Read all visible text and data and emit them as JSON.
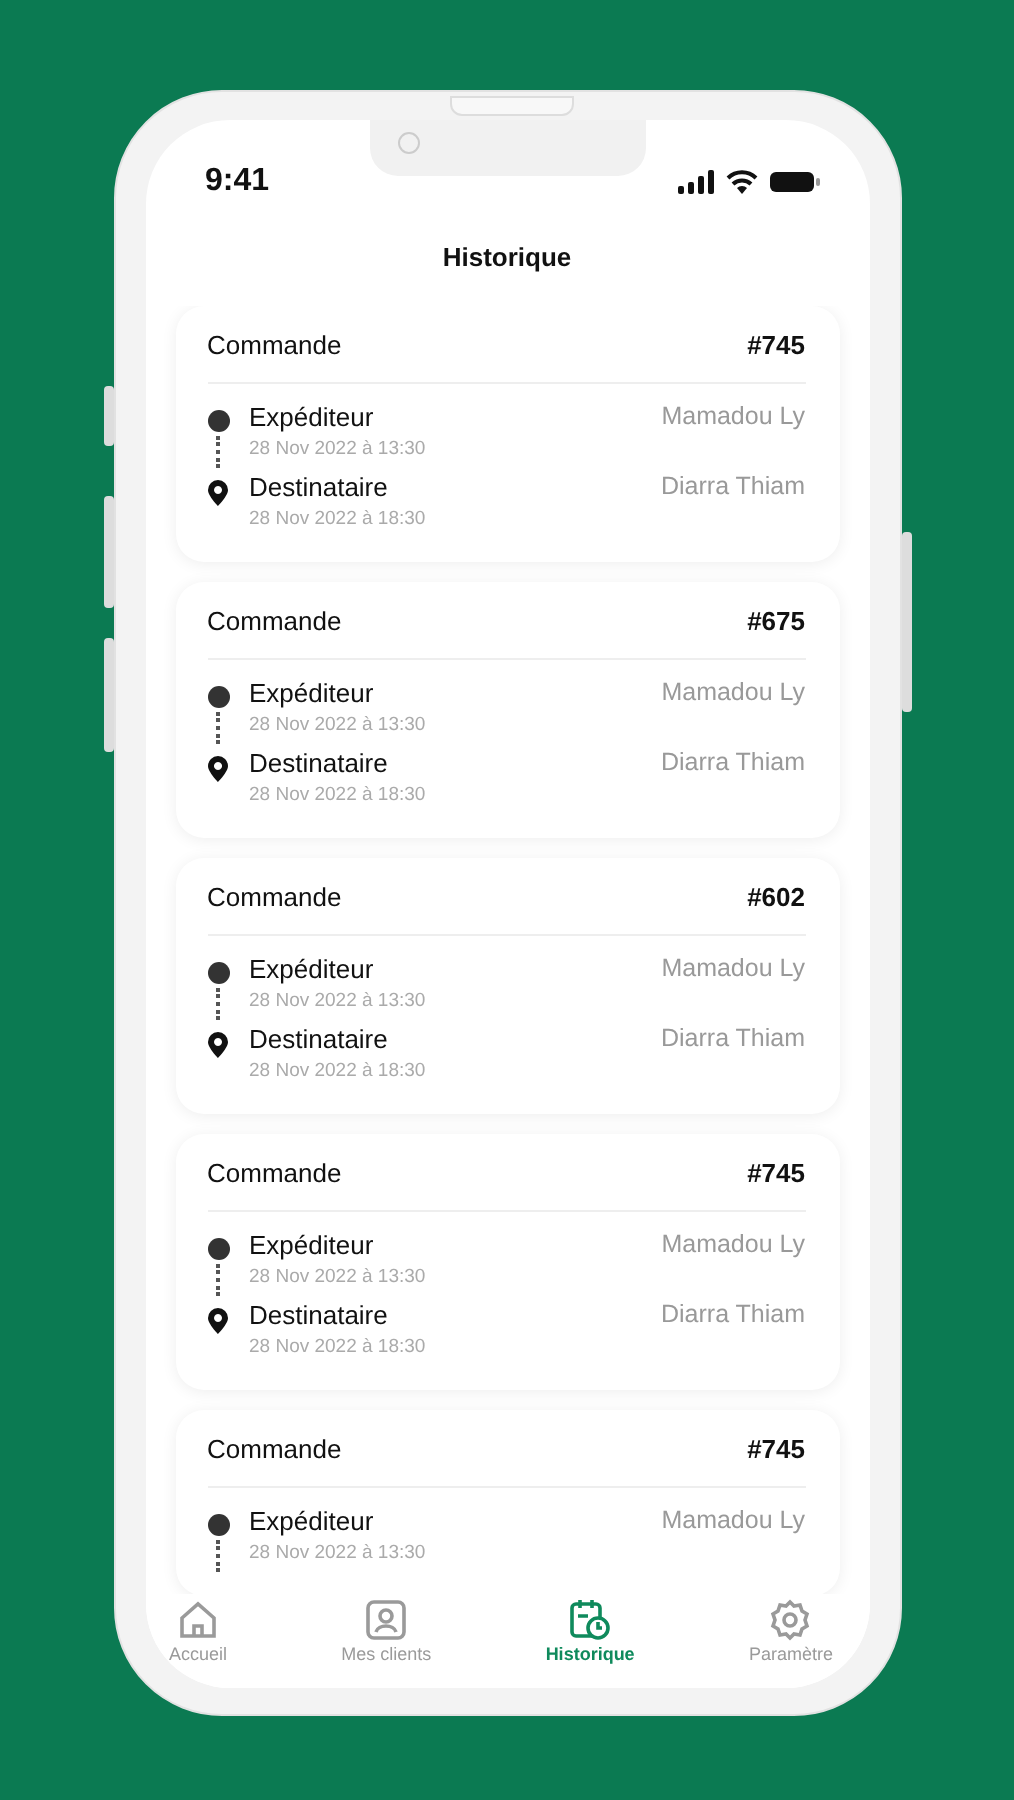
{
  "status_bar": {
    "time": "9:41"
  },
  "title": "Historique",
  "orders": [
    {
      "label": "Commande",
      "number": "#745",
      "stops": [
        {
          "kind": "sender",
          "role": "Expéditeur",
          "date": "28 Nov 2022 à 13:30",
          "name": "Mamadou Ly"
        },
        {
          "kind": "recipient",
          "role": "Destinataire",
          "date": "28 Nov 2022 à 18:30",
          "name": "Diarra Thiam"
        }
      ]
    },
    {
      "label": "Commande",
      "number": "#675",
      "stops": [
        {
          "kind": "sender",
          "role": "Expéditeur",
          "date": "28 Nov 2022 à 13:30",
          "name": "Mamadou Ly"
        },
        {
          "kind": "recipient",
          "role": "Destinataire",
          "date": "28 Nov 2022 à 18:30",
          "name": "Diarra Thiam"
        }
      ]
    },
    {
      "label": "Commande",
      "number": "#602",
      "stops": [
        {
          "kind": "sender",
          "role": "Expéditeur",
          "date": "28 Nov 2022 à 13:30",
          "name": "Mamadou Ly"
        },
        {
          "kind": "recipient",
          "role": "Destinataire",
          "date": "28 Nov 2022 à 18:30",
          "name": "Diarra Thiam"
        }
      ]
    },
    {
      "label": "Commande",
      "number": "#745",
      "stops": [
        {
          "kind": "sender",
          "role": "Expéditeur",
          "date": "28 Nov 2022 à 13:30",
          "name": "Mamadou Ly"
        },
        {
          "kind": "recipient",
          "role": "Destinataire",
          "date": "28 Nov 2022 à 18:30",
          "name": "Diarra Thiam"
        }
      ]
    },
    {
      "label": "Commande",
      "number": "#745",
      "stops": [
        {
          "kind": "sender",
          "role": "Expéditeur",
          "date": "28 Nov 2022 à 13:30",
          "name": "Mamadou Ly"
        }
      ]
    }
  ],
  "nav": [
    {
      "kind": "home",
      "label": "Accueil",
      "selected": false
    },
    {
      "kind": "clients",
      "label": "Mes clients",
      "selected": false
    },
    {
      "kind": "history",
      "label": "Historique",
      "selected": true
    },
    {
      "kind": "settings",
      "label": "Paramètre",
      "selected": false
    }
  ]
}
